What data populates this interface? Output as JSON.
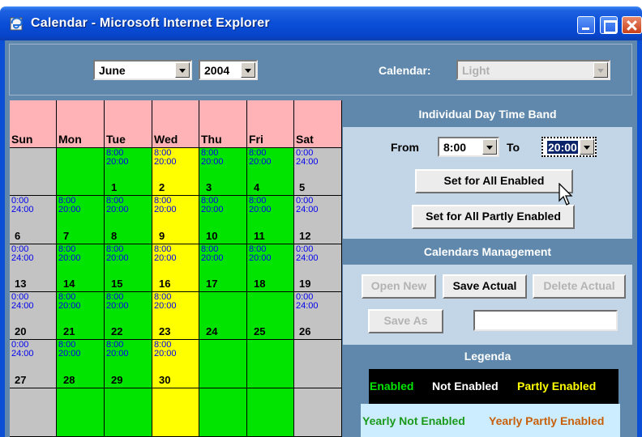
{
  "window": {
    "title": "Calendar - Microsoft Internet Explorer",
    "icon": "ie-page-icon",
    "controls": [
      "minimize-icon",
      "maximize-icon",
      "close-icon"
    ]
  },
  "header": {
    "month": "June",
    "year": "2004",
    "calendar_label": "Calendar:",
    "calendar_value": "Light"
  },
  "calendar": {
    "days": [
      "Sun",
      "Mon",
      "Tue",
      "Wed",
      "Thu",
      "Fri",
      "Sat"
    ],
    "weeks": [
      [
        {
          "day": "",
          "start": "",
          "end": "",
          "status": "gray"
        },
        {
          "day": "",
          "start": "",
          "end": "",
          "status": "green"
        },
        {
          "day": "1",
          "start": "8:00",
          "end": "20:00",
          "status": "green"
        },
        {
          "day": "2",
          "start": "8:00",
          "end": "20:00",
          "status": "yellow"
        },
        {
          "day": "3",
          "start": "8:00",
          "end": "20:00",
          "status": "green"
        },
        {
          "day": "4",
          "start": "8:00",
          "end": "20:00",
          "status": "green"
        },
        {
          "day": "5",
          "start": "0:00",
          "end": "24:00",
          "status": "gray"
        }
      ],
      [
        {
          "day": "6",
          "start": "0:00",
          "end": "24:00",
          "status": "gray"
        },
        {
          "day": "7",
          "start": "8:00",
          "end": "20:00",
          "status": "green"
        },
        {
          "day": "8",
          "start": "8:00",
          "end": "20:00",
          "status": "green"
        },
        {
          "day": "9",
          "start": "8:00",
          "end": "20:00",
          "status": "yellow"
        },
        {
          "day": "10",
          "start": "8:00",
          "end": "20:00",
          "status": "green"
        },
        {
          "day": "11",
          "start": "8:00",
          "end": "20:00",
          "status": "green"
        },
        {
          "day": "12",
          "start": "0:00",
          "end": "24:00",
          "status": "gray"
        }
      ],
      [
        {
          "day": "13",
          "start": "0:00",
          "end": "24:00",
          "status": "gray"
        },
        {
          "day": "14",
          "start": "8:00",
          "end": "20:00",
          "status": "green"
        },
        {
          "day": "15",
          "start": "8:00",
          "end": "20:00",
          "status": "green"
        },
        {
          "day": "16",
          "start": "8:00",
          "end": "20:00",
          "status": "yellow"
        },
        {
          "day": "17",
          "start": "8:00",
          "end": "20:00",
          "status": "green"
        },
        {
          "day": "18",
          "start": "8:00",
          "end": "20:00",
          "status": "green"
        },
        {
          "day": "19",
          "start": "0:00",
          "end": "24:00",
          "status": "gray"
        }
      ],
      [
        {
          "day": "20",
          "start": "0:00",
          "end": "24:00",
          "status": "gray"
        },
        {
          "day": "21",
          "start": "8:00",
          "end": "20:00",
          "status": "green"
        },
        {
          "day": "22",
          "start": "8:00",
          "end": "20:00",
          "status": "green"
        },
        {
          "day": "23",
          "start": "8:00",
          "end": "20:00",
          "status": "yellow"
        },
        {
          "day": "24",
          "start": "",
          "end": "",
          "status": "green"
        },
        {
          "day": "25",
          "start": "",
          "end": "",
          "status": "green"
        },
        {
          "day": "26",
          "start": "0:00",
          "end": "24:00",
          "status": "gray"
        }
      ],
      [
        {
          "day": "27",
          "start": "0:00",
          "end": "24:00",
          "status": "gray"
        },
        {
          "day": "28",
          "start": "8:00",
          "end": "20:00",
          "status": "green"
        },
        {
          "day": "29",
          "start": "8:00",
          "end": "20:00",
          "status": "green"
        },
        {
          "day": "30",
          "start": "8:00",
          "end": "20:00",
          "status": "yellow"
        },
        {
          "day": "",
          "start": "",
          "end": "",
          "status": "green"
        },
        {
          "day": "",
          "start": "",
          "end": "",
          "status": "green"
        },
        {
          "day": "",
          "start": "",
          "end": "",
          "status": "gray"
        }
      ],
      [
        {
          "day": "",
          "start": "",
          "end": "",
          "status": "gray"
        },
        {
          "day": "",
          "start": "",
          "end": "",
          "status": "green"
        },
        {
          "day": "",
          "start": "",
          "end": "",
          "status": "green"
        },
        {
          "day": "",
          "start": "",
          "end": "",
          "status": "yellow"
        },
        {
          "day": "",
          "start": "",
          "end": "",
          "status": "green"
        },
        {
          "day": "",
          "start": "",
          "end": "",
          "status": "green"
        },
        {
          "day": "",
          "start": "",
          "end": "",
          "status": "gray"
        }
      ]
    ]
  },
  "time_band": {
    "title": "Individual Day Time Band",
    "from_label": "From",
    "from_value": "8:00",
    "to_label": "To",
    "to_value": "20:00",
    "set_all_enabled": "Set for All Enabled",
    "set_all_partly": "Set for All Partly Enabled"
  },
  "management": {
    "title": "Calendars Management",
    "open_new": "Open New",
    "save_actual": "Save Actual",
    "delete_actual": "Delete Actual",
    "save_as": "Save As",
    "name_value": ""
  },
  "legend": {
    "title": "Legenda",
    "enabled": "Enabled",
    "not_enabled": "Not Enabled",
    "partly_enabled": "Partly Enabled",
    "yearly_not_enabled": "Yearly Not Enabled",
    "yearly_partly_enabled": "Yearly Partly Enabled"
  },
  "colors": {
    "enabled": "#00e400",
    "partly": "#ffff00",
    "not_enabled": "#c3c3c3",
    "header_row": "#ffb3b6",
    "time_text": "#0000ee",
    "yearly_not_enabled_text": "#1a9a1a",
    "yearly_partly_enabled_text": "#c8600a"
  }
}
